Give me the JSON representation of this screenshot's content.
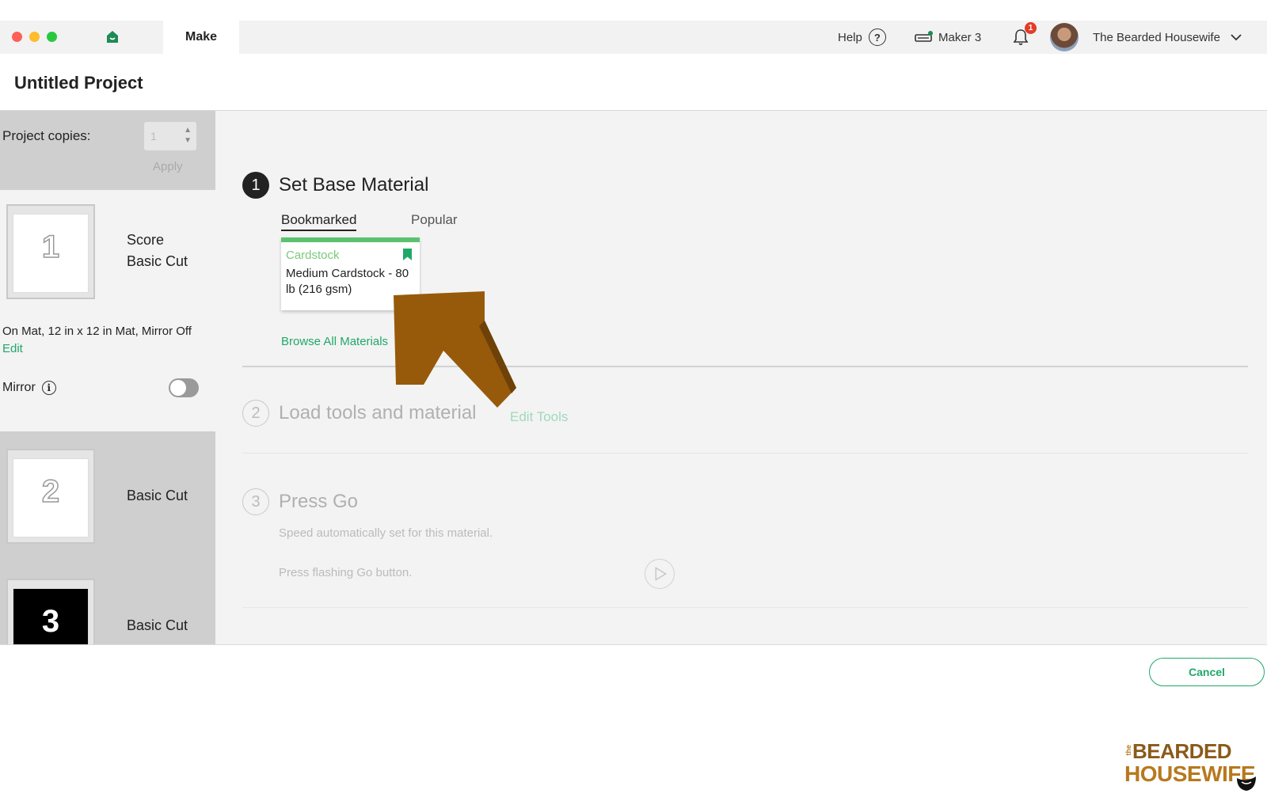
{
  "topbar": {
    "tab_make": "Make",
    "help_label": "Help",
    "help_icon_glyph": "?",
    "machine_name": "Maker 3",
    "notification_count": "1",
    "user_name": "The Bearded Housewife"
  },
  "project": {
    "title": "Untitled Project"
  },
  "left_panel": {
    "copies_label": "Project copies:",
    "copies_value": "1",
    "apply_label": "Apply",
    "mats": [
      {
        "number": "1",
        "operations": [
          "Score",
          "Basic Cut"
        ]
      },
      {
        "number": "2",
        "operations": [
          "Basic Cut"
        ]
      },
      {
        "number": "3",
        "operations": [
          "Basic Cut"
        ]
      }
    ],
    "mat_details": "On Mat, 12 in x 12 in Mat, Mirror Off",
    "edit_label": "Edit",
    "mirror_label": "Mirror",
    "mirror_on": false
  },
  "steps": [
    {
      "number": "1",
      "title": "Set Base Material",
      "tabs": [
        "Bookmarked",
        "Popular"
      ],
      "active_tab": "Bookmarked",
      "material_category": "Cardstock",
      "material_name": "Medium Cardstock - 80 lb (216 gsm)",
      "browse_label": "Browse All Materials"
    },
    {
      "number": "2",
      "title": "Load tools and material",
      "edit_tools_label": "Edit Tools"
    },
    {
      "number": "3",
      "title": "Press Go",
      "speed_text": "Speed automatically set for this material.",
      "press_text": "Press flashing Go button."
    }
  ],
  "footer": {
    "cancel_label": "Cancel"
  },
  "logo": {
    "small": "the",
    "line1": "BEARDED",
    "line2": "HOUSEWIFE"
  },
  "colors": {
    "accent_green": "#1fa86a",
    "annotation_arrow": "#975a0b"
  }
}
